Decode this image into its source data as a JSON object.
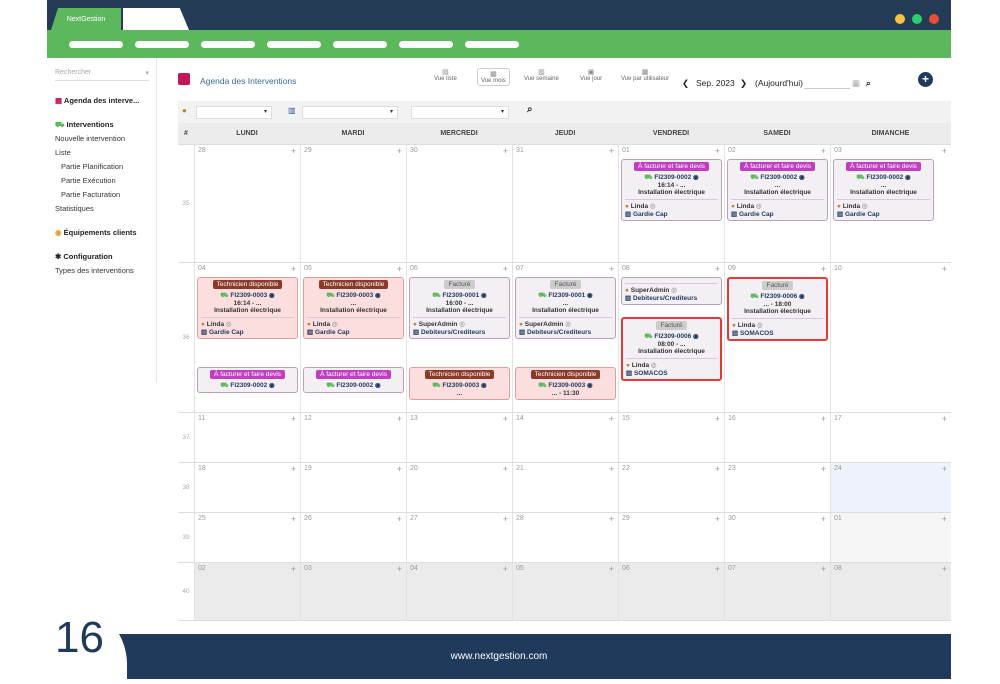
{
  "app": {
    "name": "NextGestion"
  },
  "window_dots": [
    "#f6c244",
    "#2ecc71",
    "#e74c3c"
  ],
  "sidebar": {
    "search_placeholder": "Rechercher",
    "items": [
      {
        "label": "Agenda des interve...",
        "bold": true
      },
      {
        "label": "Interventions",
        "bold": true
      },
      {
        "label": "Nouvelle intervention"
      },
      {
        "label": "Liste"
      },
      {
        "label": "Partie Planification"
      },
      {
        "label": "Partie Exécution"
      },
      {
        "label": "Partie Facturation"
      },
      {
        "label": "Statistiques"
      },
      {
        "label": "Équipements clients",
        "bold": true
      },
      {
        "label": "Configuration",
        "bold": true
      },
      {
        "label": "Types des interventions"
      }
    ]
  },
  "header": {
    "title": "Agenda des Interventions",
    "views": [
      "Vue liste",
      "Vue mois",
      "Vue semaine",
      "Vue jour",
      "Vue par utilisateur"
    ],
    "period": "Sep. 2023",
    "today": "(Aujourd'hui)"
  },
  "dow": [
    "#",
    "LUNDI",
    "MARDI",
    "MERCREDI",
    "JEUDI",
    "VENDREDI",
    "SAMEDI",
    "DIMANCHE"
  ],
  "weeks": [
    {
      "num": "35",
      "days": [
        "28",
        "29",
        "30",
        "31",
        "01",
        "02",
        "03"
      ]
    },
    {
      "num": "36",
      "days": [
        "04",
        "05",
        "06",
        "07",
        "08",
        "09",
        "10"
      ]
    },
    {
      "num": "37",
      "days": [
        "11",
        "12",
        "13",
        "14",
        "15",
        "16",
        "17"
      ]
    },
    {
      "num": "38",
      "days": [
        "18",
        "19",
        "20",
        "21",
        "22",
        "23",
        "24"
      ]
    },
    {
      "num": "39",
      "days": [
        "25",
        "26",
        "27",
        "28",
        "29",
        "30",
        "01"
      ]
    },
    {
      "num": "40",
      "days": [
        "02",
        "03",
        "04",
        "05",
        "06",
        "07",
        "08"
      ]
    }
  ],
  "events": {
    "badge_facturer": "À facturer et faire devis",
    "badge_tech": "Technicien disponible",
    "badge_facture": "Facturé",
    "fi2": "FI2309-0002",
    "fi3": "FI2309-0003",
    "fi1": "FI2309-0001",
    "fi6": "FI2309-0006",
    "t1614": "16:14 - ...",
    "t1600": "16:00 - ...",
    "t0800": "08:00 - ...",
    "t1800": "... - 18:00",
    "t1130": "... - 11:30",
    "dots": "...",
    "ie": "Installation électrique",
    "linda": "Linda",
    "superadmin": "SuperAdmin",
    "gardie": "Gardie Cap",
    "debiteurs": "Debiteurs/Crediteurs",
    "somacos": "SOMACOS"
  },
  "footer": {
    "url": "www.nextgestion.com",
    "slide": "16"
  }
}
